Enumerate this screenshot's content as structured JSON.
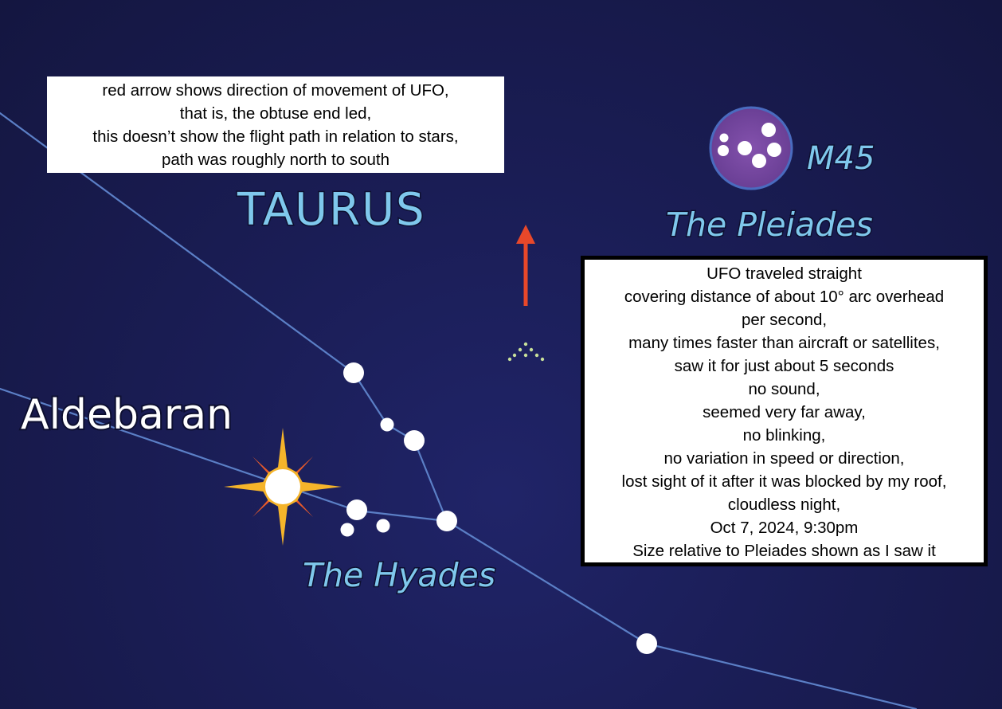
{
  "labels": {
    "taurus": "TAURUS",
    "m45": "M45",
    "pleiades": "The Pleiades",
    "aldebaran": "Aldebaran",
    "hyades": "The Hyades"
  },
  "notes": {
    "top": {
      "lines": [
        "red arrow shows direction of movement of UFO,",
        "that is, the obtuse end led,",
        "this doesn’t show the flight path in relation to stars,",
        "path was roughly north to south"
      ]
    },
    "right": {
      "lines": [
        "UFO traveled straight",
        "covering distance of about 10° arc overhead",
        "per second,",
        "many times faster than aircraft or satellites,",
        "saw it for just about 5 seconds",
        "no sound,",
        "seemed very far away,",
        "no blinking,",
        "no variation in speed or direction,",
        "lost sight of it after it was blocked by my roof,",
        "cloudless night,",
        "Oct 7, 2024, 9:30pm",
        "Size relative to Pleiades shown as I saw it"
      ]
    }
  },
  "colors": {
    "label_blue": "#7fc8ec",
    "label_white": "#ffffff",
    "line_blue": "#5b7fc6",
    "arrow_red": "#e8482a",
    "pleiades_fill": "#7a4aa0",
    "ufo_dots": "#c8e09a",
    "star_gold": "#f5b42a"
  }
}
